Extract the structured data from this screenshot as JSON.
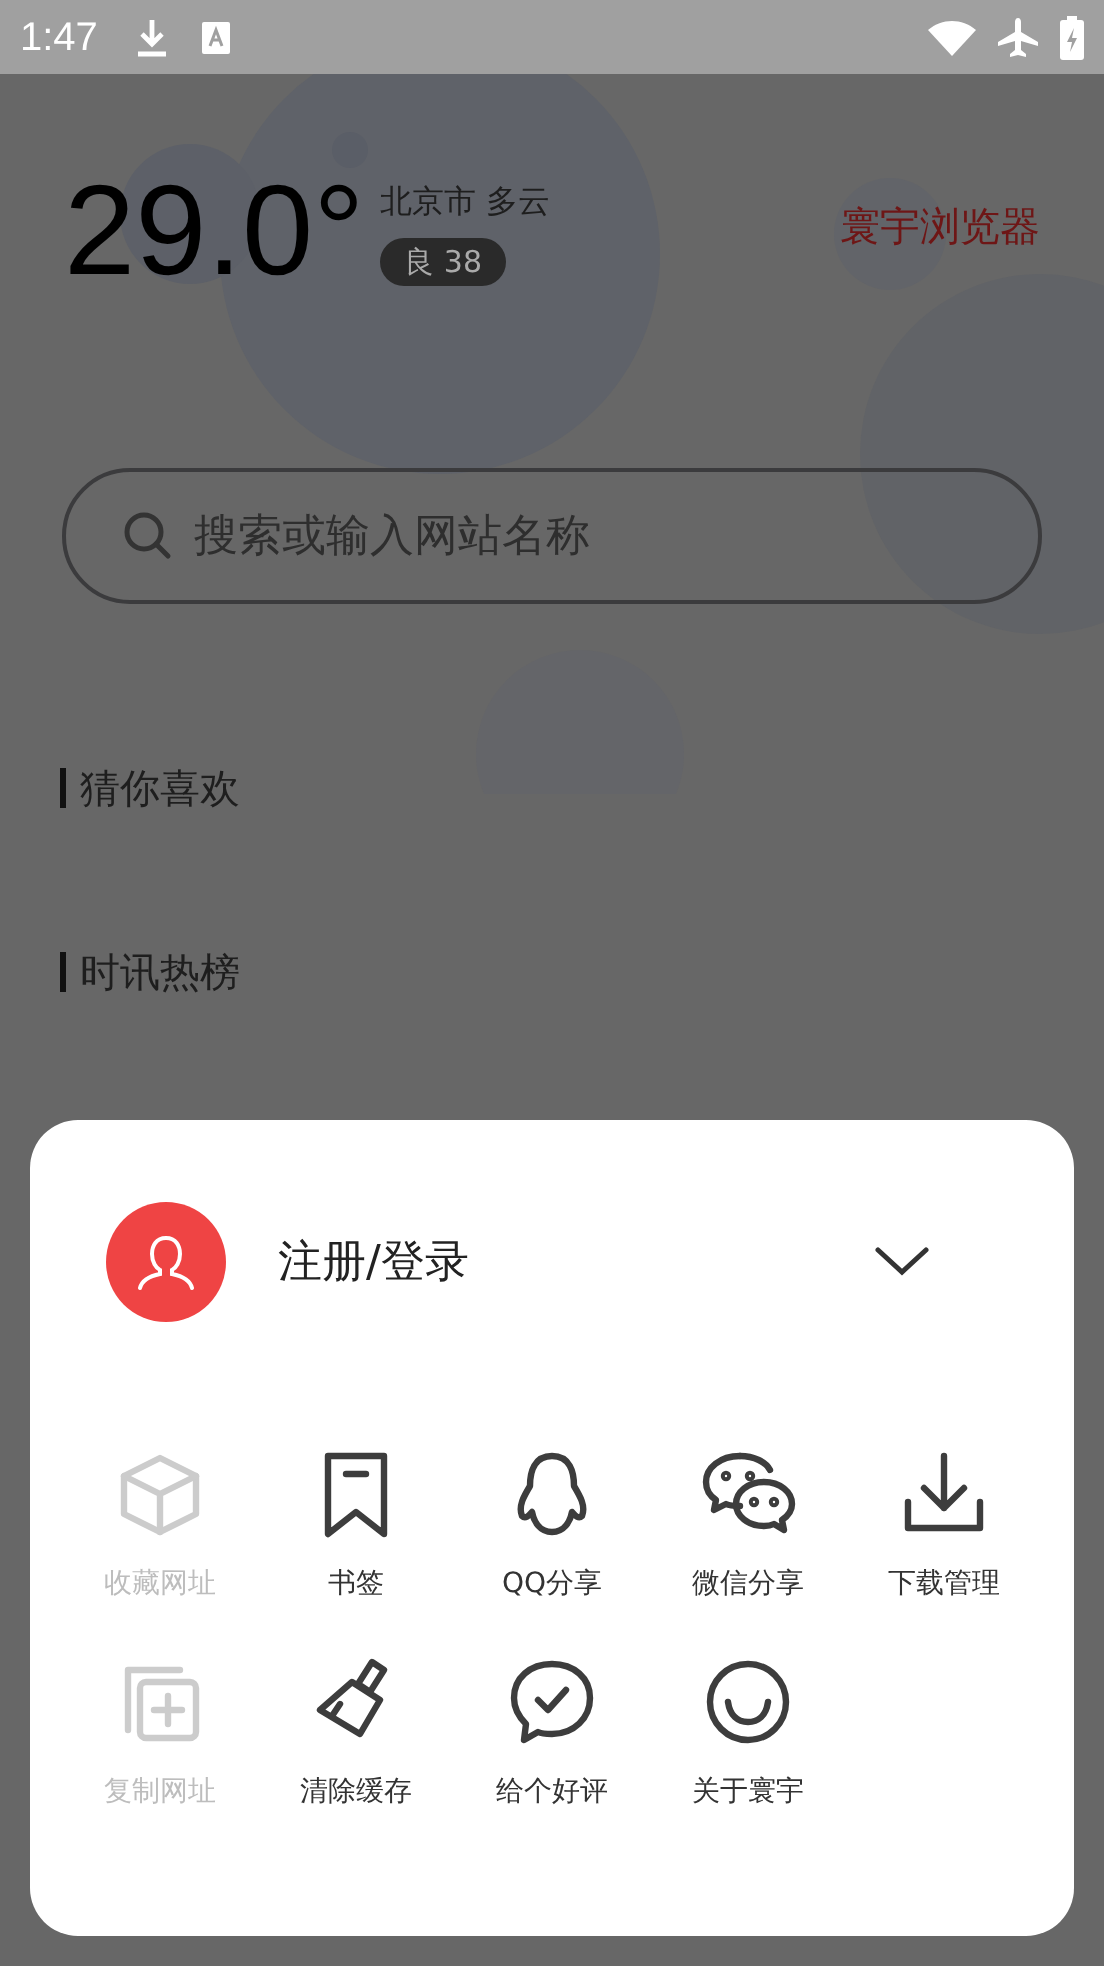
{
  "status_bar": {
    "time": "1:47"
  },
  "weather": {
    "temperature": "29.0°",
    "location": "北京市 多云",
    "air_quality": "良 38"
  },
  "brand": "寰宇浏览器",
  "search": {
    "placeholder": "搜索或输入网站名称"
  },
  "sections": [
    {
      "title": "猜你喜欢"
    },
    {
      "title": "时讯热榜"
    }
  ],
  "menu": {
    "account": {
      "label": "注册/登录"
    },
    "items": [
      {
        "kind": "cube",
        "label": "收藏网址",
        "disabled": true
      },
      {
        "kind": "bookmark",
        "label": "书签",
        "disabled": false
      },
      {
        "kind": "penguin",
        "label": "QQ分享",
        "disabled": false
      },
      {
        "kind": "chat",
        "label": "微信分享",
        "disabled": false
      },
      {
        "kind": "download",
        "label": "下载管理",
        "disabled": false
      },
      {
        "kind": "copy",
        "label": "复制网址",
        "disabled": true
      },
      {
        "kind": "brush",
        "label": "清除缓存",
        "disabled": false
      },
      {
        "kind": "rate",
        "label": "给个好评",
        "disabled": false
      },
      {
        "kind": "smile",
        "label": "关于寰宇",
        "disabled": false
      }
    ]
  }
}
